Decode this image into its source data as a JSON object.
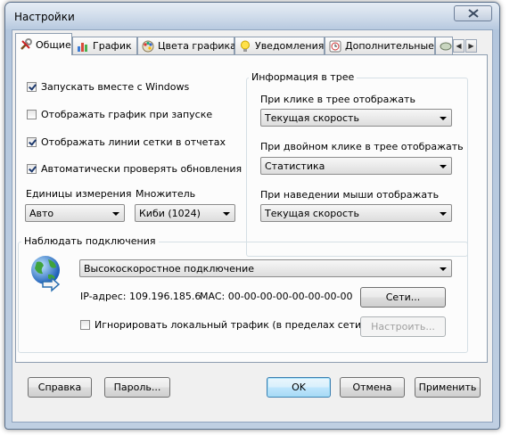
{
  "window": {
    "title": "Настройки"
  },
  "tabs": [
    {
      "label": "Общие",
      "icon": "tools-icon"
    },
    {
      "label": "График",
      "icon": "chart-icon"
    },
    {
      "label": "Цвета графика",
      "icon": "palette-icon"
    },
    {
      "label": "Уведомления",
      "icon": "bulb-icon"
    },
    {
      "label": "Дополнительные",
      "icon": "clock-icon"
    }
  ],
  "general": {
    "checkboxes": [
      {
        "label": "Запускать вместе с Windows",
        "checked": true
      },
      {
        "label": "Отображать график при запуске",
        "checked": false
      },
      {
        "label": "Отображать линии сетки в отчетах",
        "checked": true
      },
      {
        "label": "Автоматически проверять обновления",
        "checked": true
      }
    ],
    "units_label": "Единицы измерения",
    "units_value": "Авто",
    "multiplier_label": "Множитель",
    "multiplier_value": "Киби (1024)"
  },
  "tray": {
    "title": "Информация в трее",
    "click_label": "При клике в трее отображать",
    "click_value": "Текущая скорость",
    "dblclick_label": "При двойном клике в трее отображать",
    "dblclick_value": "Статистика",
    "hover_label": "При наведении мыши отображать",
    "hover_value": "Текущая скорость"
  },
  "connection": {
    "title": "Наблюдать подключения",
    "selected": "Высокоскоростное подключение",
    "ip_text": "IP-адрес: 109.196.185.6",
    "mac_text": "MAC: 00-00-00-00-00-00-00-00",
    "networks_button": "Сети...",
    "ignore_local_label": "Игнорировать локальный трафик (в пределах сети)",
    "ignore_local_checked": false,
    "configure_button": "Настроить..."
  },
  "footer": {
    "help": "Справка",
    "password": "Пароль...",
    "ok": "OK",
    "cancel": "Отмена",
    "apply": "Применить"
  },
  "colors": {
    "accent": "#3c7fb1",
    "frame": "#b9cbe0"
  }
}
